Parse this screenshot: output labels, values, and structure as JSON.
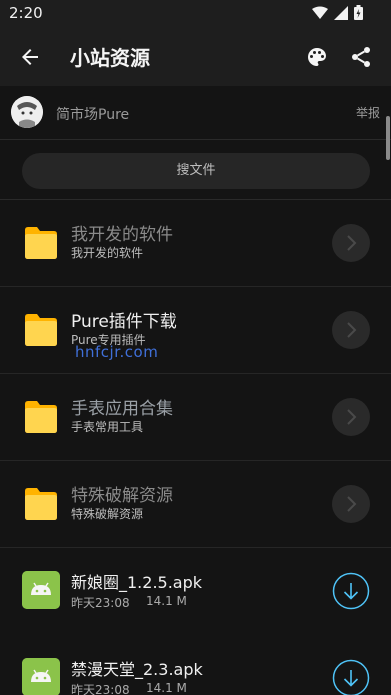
{
  "status_bar": {
    "time": "2:20"
  },
  "app_bar": {
    "title": "小站资源"
  },
  "author": {
    "name": "简市场Pure",
    "report_label": "举报"
  },
  "search": {
    "label": "搜文件"
  },
  "folders": [
    {
      "title": "我开发的软件",
      "subtitle": "我开发的软件"
    },
    {
      "title": "Pure插件下载",
      "subtitle": "Pure专用插件"
    },
    {
      "title": "手表应用合集",
      "subtitle": "手表常用工具"
    },
    {
      "title": "特殊破解资源",
      "subtitle": "特殊破解资源"
    }
  ],
  "files": [
    {
      "name": "新娘圈_1.2.5.apk",
      "date": "昨天23:08",
      "size": "14.1 M"
    },
    {
      "name": "禁漫天堂_2.3.apk",
      "date": "昨天23:08",
      "size": "14.1 M"
    }
  ],
  "watermark": "hnfcjr.com",
  "colors": {
    "accent": "#4fc3f7",
    "folder": "#ffca28",
    "apk": "#8bc34a"
  }
}
